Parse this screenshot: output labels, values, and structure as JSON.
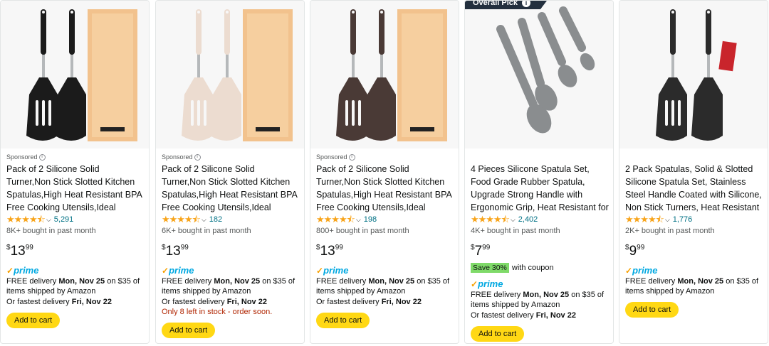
{
  "products": [
    {
      "badge": "",
      "sponsored": "Sponsored",
      "title": "Pack of 2 Silicone Solid Turner,Non Stick Slotted Kitchen Spatulas,High Heat Resistant BPA Free Cooking Utensils,Ideal Cookware for...",
      "stars": "★★★★⯪",
      "rating_value": 4.5,
      "rating_count": "5,291",
      "bought": "8K+ bought in past month",
      "price_symbol": "$",
      "price_whole": "13",
      "price_fraction": "99",
      "save": "",
      "save_suffix": "",
      "prime": "prime",
      "delivery_prefix": "FREE delivery ",
      "delivery_date": "Mon, Nov 25",
      "delivery_suffix": " on $35 of items shipped by Amazon",
      "fastest_prefix": "Or fastest delivery ",
      "fastest_date": "Fri, Nov 22",
      "stock": "",
      "cart_label": "Add to cart",
      "color": "#1b1b1b"
    },
    {
      "badge": "",
      "sponsored": "Sponsored",
      "title": "Pack of 2 Silicone Solid Turner,Non Stick Slotted Kitchen Spatulas,High Heat Resistant BPA Free Cooking Utensils,Ideal Cookware for...",
      "stars": "★★★★⯪",
      "rating_value": 4.5,
      "rating_count": "182",
      "bought": "6K+ bought in past month",
      "price_symbol": "$",
      "price_whole": "13",
      "price_fraction": "99",
      "save": "",
      "save_suffix": "",
      "prime": "prime",
      "delivery_prefix": "FREE delivery ",
      "delivery_date": "Mon, Nov 25",
      "delivery_suffix": " on $35 of items shipped by Amazon",
      "fastest_prefix": "Or fastest delivery ",
      "fastest_date": "Fri, Nov 22",
      "stock": "Only 8 left in stock - order soon.",
      "cart_label": "Add to cart",
      "color": "#ecdcd0"
    },
    {
      "badge": "",
      "sponsored": "Sponsored",
      "title": "Pack of 2 Silicone Solid Turner,Non Stick Slotted Kitchen Spatulas,High Heat Resistant BPA Free Cooking Utensils,Ideal Cookware for...",
      "stars": "★★★★⯪",
      "rating_value": 4.5,
      "rating_count": "198",
      "bought": "800+ bought in past month",
      "price_symbol": "$",
      "price_whole": "13",
      "price_fraction": "99",
      "save": "",
      "save_suffix": "",
      "prime": "prime",
      "delivery_prefix": "FREE delivery ",
      "delivery_date": "Mon, Nov 25",
      "delivery_suffix": " on $35 of items shipped by Amazon",
      "fastest_prefix": "Or fastest delivery ",
      "fastest_date": "Fri, Nov 22",
      "stock": "",
      "cart_label": "Add to cart",
      "color": "#4a3a36"
    },
    {
      "badge": "Overall Pick",
      "sponsored": "",
      "title": "4 Pieces Silicone Spatula Set, Food Grade Rubber Spatula, Upgrade Strong Handle with Ergonomic Grip, Heat Resistant for Nonstick...",
      "stars": "★★★★⯪",
      "rating_value": 4.5,
      "rating_count": "2,402",
      "bought": "4K+ bought in past month",
      "price_symbol": "$",
      "price_whole": "7",
      "price_fraction": "99",
      "save": "Save 30%",
      "save_suffix": "with coupon",
      "prime": "prime",
      "delivery_prefix": "FREE delivery ",
      "delivery_date": "Mon, Nov 25",
      "delivery_suffix": " on $35 of items shipped by Amazon",
      "fastest_prefix": "Or fastest delivery ",
      "fastest_date": "Fri, Nov 22",
      "stock": "",
      "cart_label": "Add to cart",
      "color": "#8a8d8f"
    },
    {
      "badge": "",
      "sponsored": "",
      "title": "2 Pack Spatulas, Solid & Slotted Silicone Spatula Set, Stainless Steel Handle Coated with Silicone, Non Stick Turners, Heat Resistant Rubbe...",
      "stars": "★★★★⯪",
      "rating_value": 4.5,
      "rating_count": "1,776",
      "bought": "2K+ bought in past month",
      "price_symbol": "$",
      "price_whole": "9",
      "price_fraction": "99",
      "save": "",
      "save_suffix": "",
      "prime": "prime",
      "delivery_prefix": "FREE delivery ",
      "delivery_date": "Mon, Nov 25",
      "delivery_suffix": " on $35 of items shipped by Amazon",
      "fastest_prefix": "",
      "fastest_date": "",
      "stock": "",
      "cart_label": "Add to cart",
      "color": "#2b2b2b"
    }
  ]
}
